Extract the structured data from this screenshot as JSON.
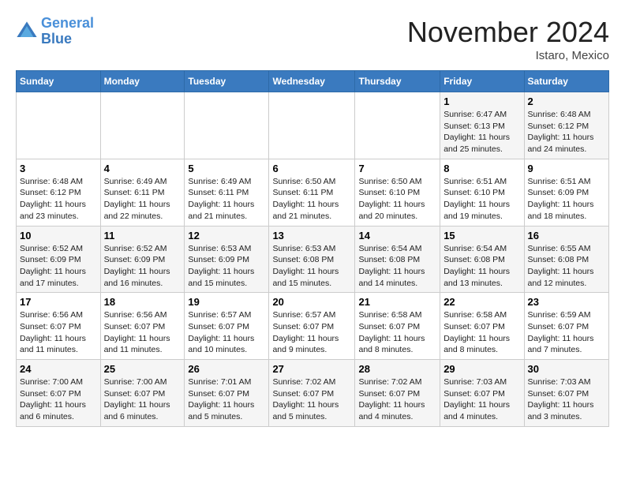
{
  "logo": {
    "line1": "General",
    "line2": "Blue"
  },
  "title": "November 2024",
  "location": "Istaro, Mexico",
  "days_of_week": [
    "Sunday",
    "Monday",
    "Tuesday",
    "Wednesday",
    "Thursday",
    "Friday",
    "Saturday"
  ],
  "weeks": [
    [
      {
        "day": "",
        "info": ""
      },
      {
        "day": "",
        "info": ""
      },
      {
        "day": "",
        "info": ""
      },
      {
        "day": "",
        "info": ""
      },
      {
        "day": "",
        "info": ""
      },
      {
        "day": "1",
        "info": "Sunrise: 6:47 AM\nSunset: 6:13 PM\nDaylight: 11 hours and 25 minutes."
      },
      {
        "day": "2",
        "info": "Sunrise: 6:48 AM\nSunset: 6:12 PM\nDaylight: 11 hours and 24 minutes."
      }
    ],
    [
      {
        "day": "3",
        "info": "Sunrise: 6:48 AM\nSunset: 6:12 PM\nDaylight: 11 hours and 23 minutes."
      },
      {
        "day": "4",
        "info": "Sunrise: 6:49 AM\nSunset: 6:11 PM\nDaylight: 11 hours and 22 minutes."
      },
      {
        "day": "5",
        "info": "Sunrise: 6:49 AM\nSunset: 6:11 PM\nDaylight: 11 hours and 21 minutes."
      },
      {
        "day": "6",
        "info": "Sunrise: 6:50 AM\nSunset: 6:11 PM\nDaylight: 11 hours and 21 minutes."
      },
      {
        "day": "7",
        "info": "Sunrise: 6:50 AM\nSunset: 6:10 PM\nDaylight: 11 hours and 20 minutes."
      },
      {
        "day": "8",
        "info": "Sunrise: 6:51 AM\nSunset: 6:10 PM\nDaylight: 11 hours and 19 minutes."
      },
      {
        "day": "9",
        "info": "Sunrise: 6:51 AM\nSunset: 6:09 PM\nDaylight: 11 hours and 18 minutes."
      }
    ],
    [
      {
        "day": "10",
        "info": "Sunrise: 6:52 AM\nSunset: 6:09 PM\nDaylight: 11 hours and 17 minutes."
      },
      {
        "day": "11",
        "info": "Sunrise: 6:52 AM\nSunset: 6:09 PM\nDaylight: 11 hours and 16 minutes."
      },
      {
        "day": "12",
        "info": "Sunrise: 6:53 AM\nSunset: 6:09 PM\nDaylight: 11 hours and 15 minutes."
      },
      {
        "day": "13",
        "info": "Sunrise: 6:53 AM\nSunset: 6:08 PM\nDaylight: 11 hours and 15 minutes."
      },
      {
        "day": "14",
        "info": "Sunrise: 6:54 AM\nSunset: 6:08 PM\nDaylight: 11 hours and 14 minutes."
      },
      {
        "day": "15",
        "info": "Sunrise: 6:54 AM\nSunset: 6:08 PM\nDaylight: 11 hours and 13 minutes."
      },
      {
        "day": "16",
        "info": "Sunrise: 6:55 AM\nSunset: 6:08 PM\nDaylight: 11 hours and 12 minutes."
      }
    ],
    [
      {
        "day": "17",
        "info": "Sunrise: 6:56 AM\nSunset: 6:07 PM\nDaylight: 11 hours and 11 minutes."
      },
      {
        "day": "18",
        "info": "Sunrise: 6:56 AM\nSunset: 6:07 PM\nDaylight: 11 hours and 11 minutes."
      },
      {
        "day": "19",
        "info": "Sunrise: 6:57 AM\nSunset: 6:07 PM\nDaylight: 11 hours and 10 minutes."
      },
      {
        "day": "20",
        "info": "Sunrise: 6:57 AM\nSunset: 6:07 PM\nDaylight: 11 hours and 9 minutes."
      },
      {
        "day": "21",
        "info": "Sunrise: 6:58 AM\nSunset: 6:07 PM\nDaylight: 11 hours and 8 minutes."
      },
      {
        "day": "22",
        "info": "Sunrise: 6:58 AM\nSunset: 6:07 PM\nDaylight: 11 hours and 8 minutes."
      },
      {
        "day": "23",
        "info": "Sunrise: 6:59 AM\nSunset: 6:07 PM\nDaylight: 11 hours and 7 minutes."
      }
    ],
    [
      {
        "day": "24",
        "info": "Sunrise: 7:00 AM\nSunset: 6:07 PM\nDaylight: 11 hours and 6 minutes."
      },
      {
        "day": "25",
        "info": "Sunrise: 7:00 AM\nSunset: 6:07 PM\nDaylight: 11 hours and 6 minutes."
      },
      {
        "day": "26",
        "info": "Sunrise: 7:01 AM\nSunset: 6:07 PM\nDaylight: 11 hours and 5 minutes."
      },
      {
        "day": "27",
        "info": "Sunrise: 7:02 AM\nSunset: 6:07 PM\nDaylight: 11 hours and 5 minutes."
      },
      {
        "day": "28",
        "info": "Sunrise: 7:02 AM\nSunset: 6:07 PM\nDaylight: 11 hours and 4 minutes."
      },
      {
        "day": "29",
        "info": "Sunrise: 7:03 AM\nSunset: 6:07 PM\nDaylight: 11 hours and 4 minutes."
      },
      {
        "day": "30",
        "info": "Sunrise: 7:03 AM\nSunset: 6:07 PM\nDaylight: 11 hours and 3 minutes."
      }
    ]
  ]
}
